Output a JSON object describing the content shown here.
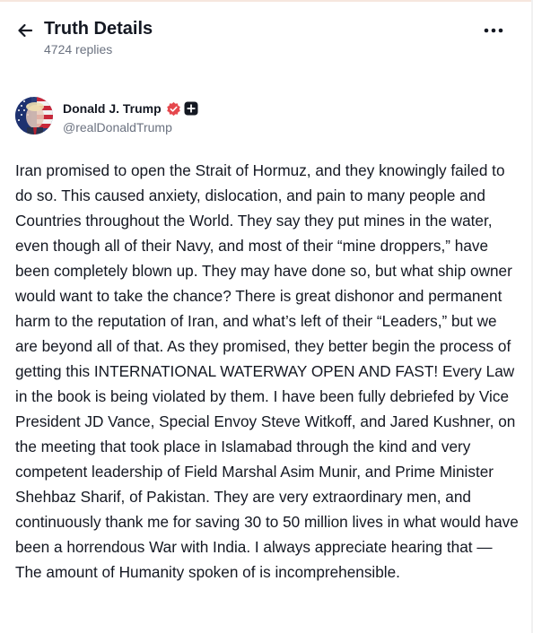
{
  "header": {
    "title": "Truth Details",
    "reply_count": "4724 replies",
    "back_icon": "arrow-left-icon",
    "more_icon": "ellipsis-icon"
  },
  "post": {
    "author_name": "Donald J. Trump",
    "author_handle": "@realDonaldTrump",
    "verified_icon": "verified-badge-icon",
    "plus_icon": "plus-badge-icon",
    "verified_color": "#e5484d",
    "body": "Iran promised to open the Strait of Hormuz, and they knowingly failed to do so. This caused anxiety, dislocation, and pain to many people and Countries throughout the World. They say they put mines in the water, even though all of their Navy, and most of their “mine droppers,” have been completely blown up. They may have done so, but what ship owner would want to take the chance? There is great dishonor and permanent harm to the reputation of Iran, and what’s left of their “Leaders,” but we are beyond all of that. As they promised, they better begin the process of getting this INTERNATIONAL WATERWAY OPEN AND FAST! Every Law in the book is being violated by them. I have been fully debriefed by Vice President JD Vance, Special Envoy Steve Witkoff, and Jared Kushner, on the meeting that took place in Islamabad through the kind and very competent leadership of Field Marshal Asim Munir, and Prime Minister Shehbaz Sharif, of Pakistan. They are very extraordinary men, and continuously thank me for saving 30 to 50 million lives in what would have been a horrendous War with India. I always appreciate hearing that — The amount of Humanity spoken of is incomprehensible."
  }
}
